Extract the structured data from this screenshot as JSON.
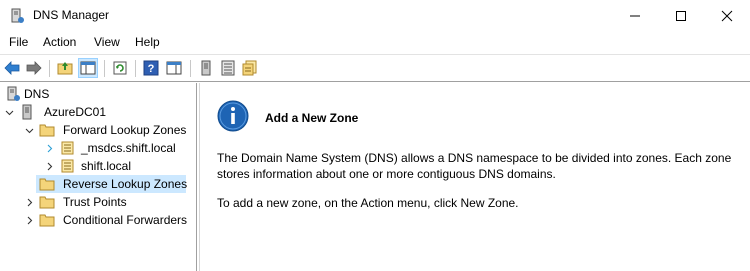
{
  "window": {
    "title": "DNS Manager",
    "icon": "dns-server-icon"
  },
  "menu": {
    "items": [
      "File",
      "Action",
      "View",
      "Help"
    ]
  },
  "toolbar": {
    "buttons": [
      "back-arrow-icon",
      "forward-arrow-icon",
      "up-folder-icon",
      "show-hide-tree-icon",
      "refresh-icon",
      "help-icon",
      "action-pane-icon",
      "server-icon",
      "list-icon",
      "properties-icon"
    ]
  },
  "tree": {
    "items": [
      {
        "label": "DNS",
        "icon": "dns-icon"
      },
      {
        "label": "AzureDC01",
        "icon": "server-icon"
      },
      {
        "label": "Forward Lookup Zones",
        "icon": "folder-icon"
      },
      {
        "label": "_msdcs.shift.local",
        "icon": "zone-icon"
      },
      {
        "label": "shift.local",
        "icon": "zone-icon"
      },
      {
        "label": "Reverse Lookup Zones",
        "icon": "folder-icon",
        "selected": true
      },
      {
        "label": "Trust Points",
        "icon": "folder-icon"
      },
      {
        "label": "Conditional Forwarders",
        "icon": "folder-icon"
      }
    ]
  },
  "details": {
    "heading": "Add a New Zone",
    "paragraph1": "The Domain Name System (DNS) allows a DNS namespace to be divided into zones. Each zone stores information about one or more contiguous DNS domains.",
    "paragraph2": "To add a new zone, on the Action menu, click New Zone."
  },
  "colors": {
    "selection": "#cce8ff",
    "accent_blue": "#1e64b4",
    "folder": "#f4d47a"
  }
}
